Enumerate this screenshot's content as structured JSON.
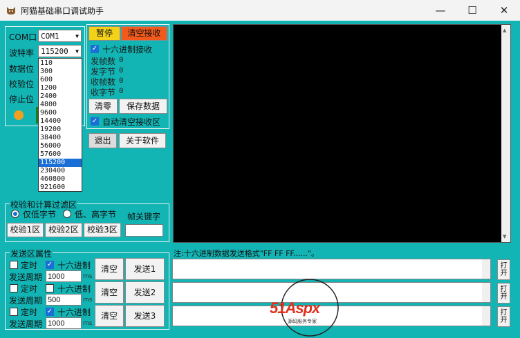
{
  "window": {
    "title": "阿猫基础串口调试助手",
    "minimize": "—",
    "maximize": "☐",
    "close": "✕"
  },
  "serial": {
    "com_label": "COM口",
    "com_value": "COM1",
    "baud_label": "波特率",
    "baud_value": "115200",
    "databits_label": "数据位",
    "parity_label": "校验位",
    "stopbits_label": "停止位",
    "baud_options": [
      "110",
      "300",
      "600",
      "1200",
      "2400",
      "4800",
      "9600",
      "14400",
      "19200",
      "38400",
      "56000",
      "57600",
      "115200",
      "230400",
      "460800",
      "921600"
    ],
    "baud_selected": "115200"
  },
  "receive": {
    "pause": "暂停",
    "clear_recv": "清空接收",
    "hex_recv": "十六进制接收",
    "sent_frames_label": "发帧数",
    "sent_frames": "0",
    "sent_bytes_label": "发字节",
    "sent_bytes": "0",
    "recv_frames_label": "收帧数",
    "recv_frames": "0",
    "recv_bytes_label": "收字节",
    "recv_bytes": "0",
    "clear_zero": "清零",
    "save_data": "保存数据",
    "auto_clear": "自动清空接收区",
    "exit": "退出",
    "about": "关于软件"
  },
  "checksum": {
    "group_title": "校验和计算过滤区",
    "low_byte": "仅低字节",
    "low_high_byte": "低、高字节",
    "frame_keyword": "帧关键字",
    "check1": "校验1区",
    "check2": "校验2区",
    "check3": "校验3区"
  },
  "send_props": {
    "group_title": "发送区属性",
    "rows": [
      {
        "timer": "定时",
        "timer_checked": false,
        "hex": "十六进制",
        "hex_checked": true,
        "period_label": "发送周期",
        "period": "1000",
        "unit": "ms",
        "clear": "清空",
        "send": "发送1"
      },
      {
        "timer": "定时",
        "timer_checked": false,
        "hex": "十六进制",
        "hex_checked": false,
        "period_label": "发送周期",
        "period": "500",
        "unit": "ms",
        "clear": "清空",
        "send": "发送2"
      },
      {
        "timer": "定时",
        "timer_checked": false,
        "hex": "十六进制",
        "hex_checked": true,
        "period_label": "发送周期",
        "period": "1000",
        "unit": "ms",
        "clear": "清空",
        "send": "发送3"
      }
    ]
  },
  "send_area": {
    "note": "注:十六进制数据发送格式\"FF FF FF......\"。",
    "open_label": "打开"
  },
  "watermark": {
    "brand": "51Aspx",
    "sub": "源码服务专家"
  },
  "colors": {
    "background": "#13b4b4",
    "pause_bg": "#f5d21a",
    "clear_bg": "#f25a1c",
    "status_led": "#f0a020",
    "accent": "#1a6fd6"
  }
}
